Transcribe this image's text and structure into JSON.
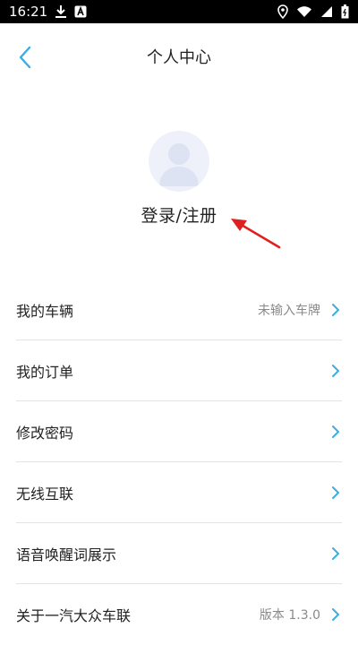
{
  "status_bar": {
    "time": "16:21",
    "icons": [
      "download-icon",
      "app-notification-icon",
      "location-icon",
      "wifi-icon",
      "signal-icon",
      "battery-icon"
    ]
  },
  "header": {
    "title": "个人中心",
    "back_icon": "chevron-left-icon"
  },
  "profile": {
    "avatar_icon": "default-user-avatar-icon",
    "login_label": "登录/注册"
  },
  "annotation": {
    "arrow_color": "#e02020"
  },
  "menu": {
    "items": [
      {
        "label": "我的车辆",
        "value": "未输入车牌"
      },
      {
        "label": "我的订单",
        "value": ""
      },
      {
        "label": "修改密码",
        "value": ""
      },
      {
        "label": "无线互联",
        "value": ""
      },
      {
        "label": "语音唤醒词展示",
        "value": ""
      },
      {
        "label": "关于一汽大众车联",
        "value": "版本 1.3.0"
      }
    ]
  },
  "colors": {
    "accent": "#3aaee0",
    "divider": "#e3e3e3",
    "avatar_bg": "#eef1f9"
  }
}
